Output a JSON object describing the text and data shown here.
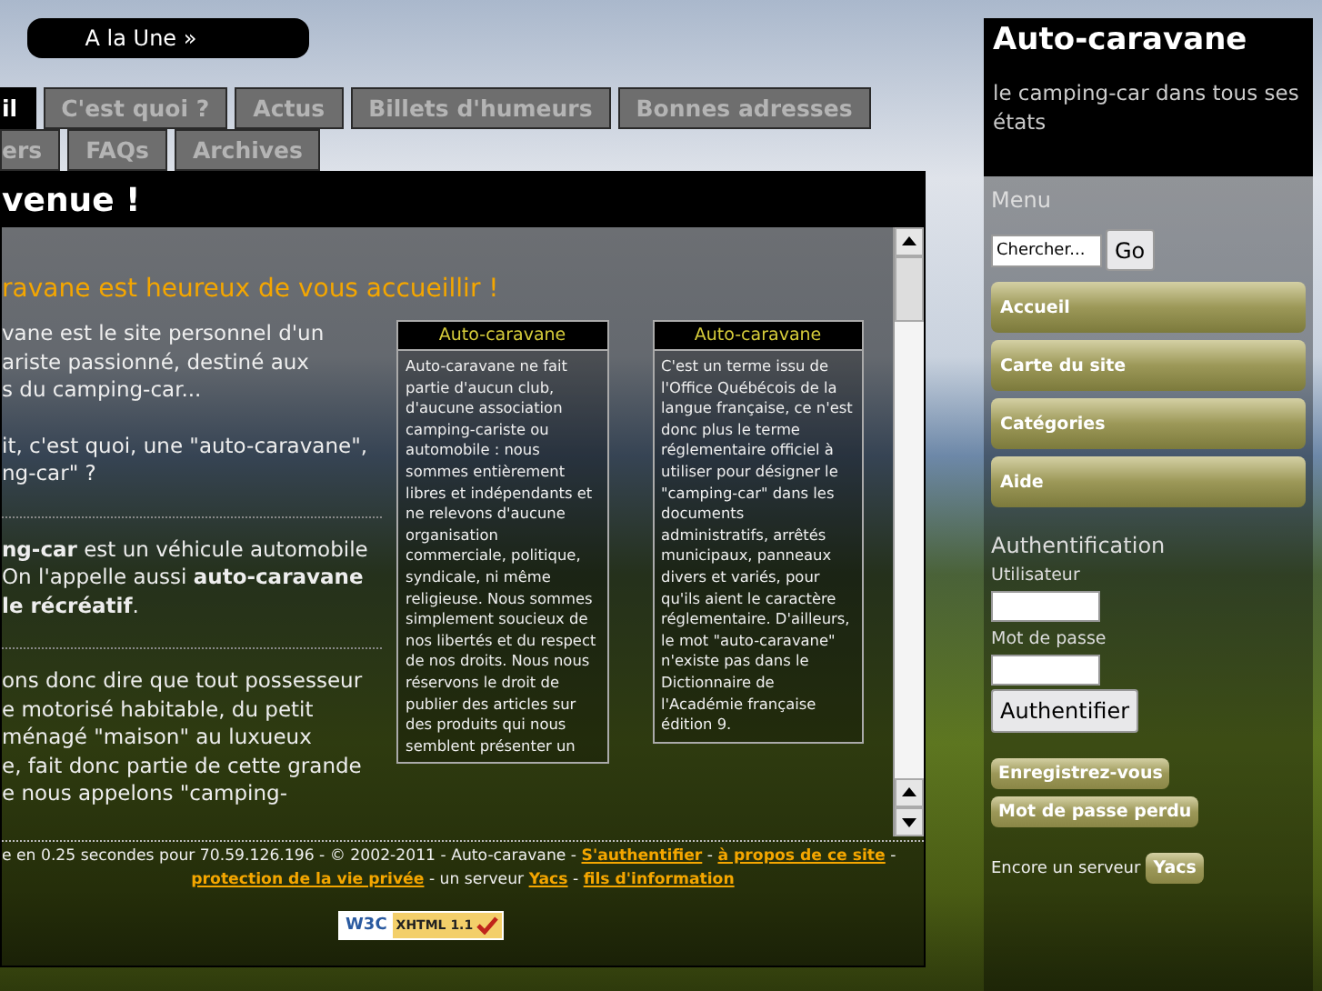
{
  "top_link": "A la Une »",
  "tabs": [
    {
      "label": "il",
      "selected": true
    },
    {
      "label": "C'est quoi ?",
      "selected": false
    },
    {
      "label": "Actus",
      "selected": false
    },
    {
      "label": "Billets d'humeurs",
      "selected": false
    },
    {
      "label": "Bonnes adresses",
      "selected": false
    }
  ],
  "tabs_row_2": [
    {
      "label": "ers",
      "selected": false
    },
    {
      "label": "FAQs",
      "selected": false
    },
    {
      "label": "Archives",
      "selected": false
    }
  ],
  "page_title": "venue !",
  "welcome": "ravane est heureux de vous accueillir !",
  "sections": [
    {
      "paragraphs": [
        [
          "vane est le site personnel d'un",
          "ariste passionné, destiné aux",
          "s du camping-car..."
        ],
        [
          "it, c'est quoi, une \"auto-caravane\",",
          "ng-car\" ?"
        ]
      ]
    },
    {
      "paragraphs": [
        [
          "**ng-car** est un véhicule automobile",
          "On l'appelle aussi **auto-caravane**",
          "**le récréatif**."
        ]
      ]
    },
    {
      "paragraphs": [
        [
          "ons donc dire que tout possesseur",
          "e motorisé habitable, du petit",
          "ménagé \"maison\" au luxueux",
          "e, fait donc partie de cette grande",
          "e nous appelons \"camping-"
        ]
      ]
    }
  ],
  "boxes": [
    {
      "title": "Auto-caravane",
      "text": "Auto-caravane ne fait partie d'aucun club, d'aucune association camping-cariste ou automobile : nous sommes entièrement libres et indépendants et ne relevons d'aucune organisation commerciale, politique, syndicale, ni même religieuse. Nous sommes simplement soucieux de nos libertés et du respect de nos droits. Nous nous réservons le droit de publier des articles sur des produits qui nous semblent présenter un"
    },
    {
      "title": "Auto-caravane",
      "text": "C'est un terme issu de l'Office Québécois de la langue française, ce n'est donc plus le terme réglementaire officiel à utiliser pour désigner le \"camping-car\" dans les documents administratifs, arrêtés municipaux, panneaux divers et variés, pour qu'ils aient le caractère réglementaire. D'ailleurs, le mot \"auto-caravane\" n'existe pas dans le Dictionnaire de l'Académie française édition 9."
    }
  ],
  "footer": {
    "lines": [
      [
        {
          "kind": "text",
          "text": "e en 0.25 secondes pour 70.59.126.196 - ©  2002-2011 - Auto-caravane - "
        },
        {
          "kind": "link",
          "text": "S'authentifier"
        },
        {
          "kind": "text",
          "text": " - "
        },
        {
          "kind": "link",
          "text": "à propos de ce site"
        },
        {
          "kind": "text",
          "text": " -"
        }
      ],
      [
        {
          "kind": "link",
          "text": "protection de la vie privée"
        },
        {
          "kind": "text",
          "text": " - un serveur "
        },
        {
          "kind": "link",
          "text": "Yacs"
        },
        {
          "kind": "text",
          "text": " - "
        },
        {
          "kind": "link",
          "text": "fils d'information"
        }
      ]
    ]
  },
  "badge": {
    "logo": "W3C",
    "label": "XHTML 1.1"
  },
  "sidebar": {
    "title": "Auto-caravane",
    "tagline": "le camping-car dans tous ses états",
    "menu_heading": "Menu",
    "search": {
      "placeholder": "Chercher...",
      "button": "Go"
    },
    "menu_items": [
      "Accueil",
      "Carte du site",
      "Catégories",
      "Aide"
    ],
    "auth_heading": "Authentification",
    "user_label": "Utilisateur",
    "password_label": "Mot de passe",
    "login_button": "Authentifier",
    "links": [
      "Enregistrez-vous",
      "Mot de passe perdu"
    ],
    "server_text": "Encore un serveur",
    "server_button": "Yacs"
  }
}
